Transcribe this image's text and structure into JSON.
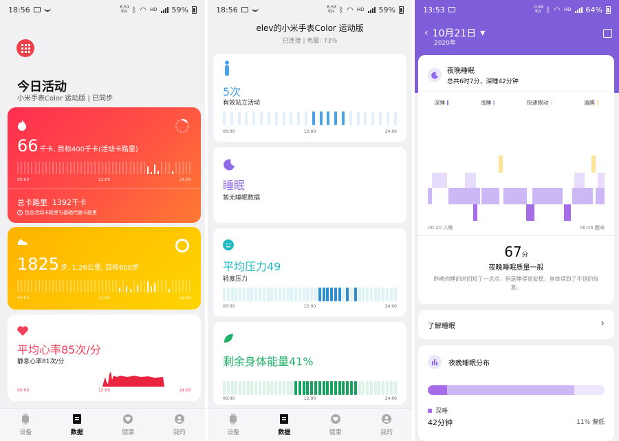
{
  "colors": {
    "red": "#ff3a4c",
    "orange": "#ffb800",
    "blue": "#4aa3e8",
    "purple": "#8e6be8",
    "teal": "#22b9c4",
    "green": "#1fb36a",
    "deep": "#a76ce8",
    "light": "#d7c8f6",
    "rem": "#e7dcfb",
    "awake": "#ffe49a"
  },
  "s1": {
    "status": {
      "time": "18:56",
      "speed": "6.51 K/s",
      "battery": "59%"
    },
    "title": "今日活动",
    "subtitle": "小米手表Color 运动版 | 已同步",
    "cal": {
      "value": "66",
      "unit": "千卡, 目标400千卡(活动卡路里)",
      "total_label": "总卡路里",
      "total_value": "1392千卡",
      "note": "包含活动卡路里与基础代谢卡路里"
    },
    "steps": {
      "value": "1825",
      "unit": "步, 1.26公里, 目标600步"
    },
    "hr": {
      "value": "平均心率85次/分",
      "rest": "静息心率81次/分"
    },
    "axis": [
      "00:00",
      "12:00",
      "24:00"
    ],
    "chart_data": [
      {
        "type": "bar",
        "series": [
          {
            "values": [
              0,
              0,
              0,
              0,
              0,
              0,
              0,
              0,
              0,
              0,
              0,
              0,
              0,
              0,
              0,
              0,
              0,
              0,
              0,
              0,
              0,
              0,
              0,
              0,
              0,
              0,
              0,
              0,
              0,
              0,
              0,
              0,
              0,
              0,
              0,
              0,
              0,
              0.6,
              0.1,
              0.8,
              0.3,
              0,
              0,
              0,
              0.2,
              0,
              0,
              0,
              0,
              0
            ]
          }
        ]
      },
      {
        "type": "bar",
        "series": [
          {
            "values": [
              0,
              0,
              0,
              0,
              0,
              0,
              0,
              0,
              0,
              0,
              0,
              0,
              0,
              0,
              0,
              0,
              0,
              0,
              0,
              0,
              0,
              0,
              0,
              0,
              0,
              0,
              0,
              0,
              0,
              0.4,
              0,
              0.5,
              0.3,
              0,
              0.6,
              0,
              0,
              0.9,
              0.5,
              0.7,
              0,
              0,
              0,
              0.3,
              0,
              0,
              0,
              0,
              0,
              0
            ]
          }
        ]
      }
    ]
  },
  "s2": {
    "status": {
      "time": "18:56",
      "speed": "6.53 K/s",
      "battery": "59%"
    },
    "device": "elev的小米手表Color 运动版",
    "device_status": "已连接 | 电量: 73%",
    "stand": {
      "value": "5次",
      "desc": "有效站立活动"
    },
    "sleep": {
      "value": "睡眠",
      "desc": "暂无睡眠数据"
    },
    "stress": {
      "value": "平均压力49",
      "desc": "轻度压力"
    },
    "energy": {
      "value": "剩余身体能量41%",
      "desc": ""
    },
    "axis": [
      "00:00",
      "12:00",
      "24:00"
    ]
  },
  "s3": {
    "status": {
      "time": "13:53",
      "speed": "0.99 K/s",
      "battery": "64%"
    },
    "date": "10月21日",
    "year": "2020年",
    "night_title": "夜晚睡眠",
    "night_total": "总共6时7分，深睡42分钟",
    "legend": [
      "深睡",
      "浅睡",
      "快速眼动",
      "清醒"
    ],
    "start": "00:20 入睡",
    "end": "06:46 醒来",
    "score": "67",
    "score_unit": "分",
    "quality": "夜晚睡眠质量一般",
    "comment": "昨晚你睡的时间短了一点点，但是睡得很安稳，身体得到了不错的恢复。",
    "learn": "了解睡眠",
    "dist_title": "夜晚睡眠分布",
    "deep_label": "深睡",
    "deep_value": "42分钟",
    "deep_pct": "11% 偏低"
  },
  "tabs": [
    "设备",
    "数据",
    "健康",
    "我的"
  ]
}
